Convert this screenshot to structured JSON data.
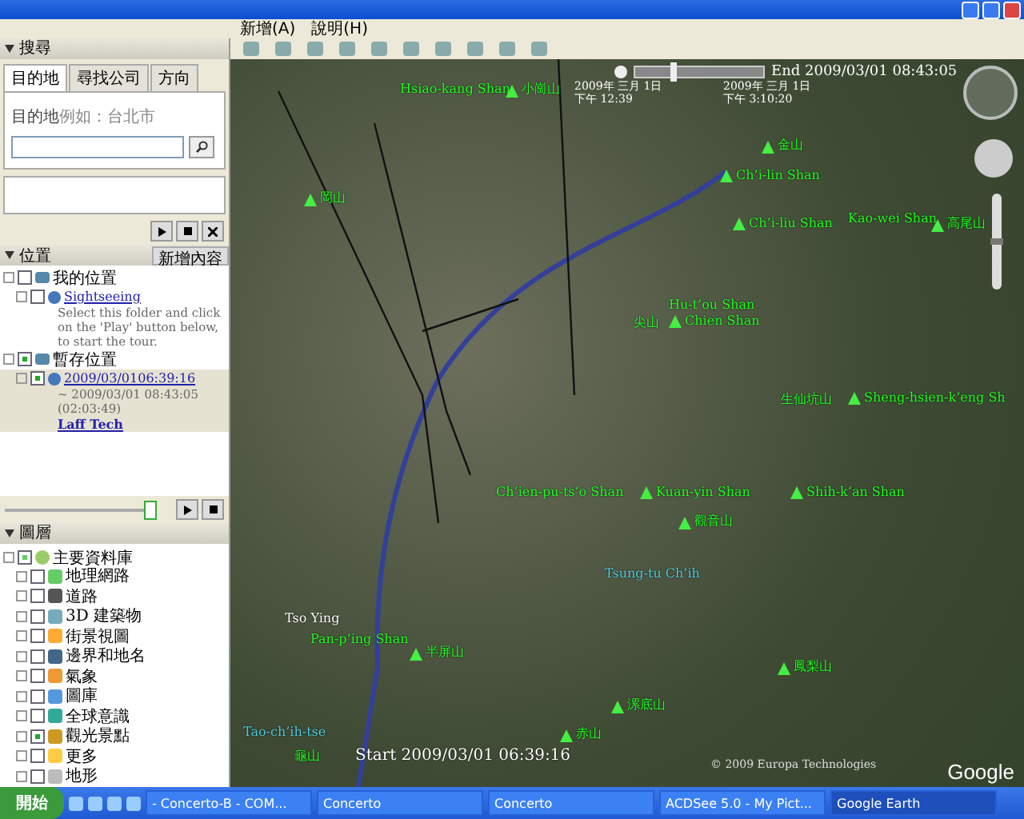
{
  "menu": [
    "新增(A)",
    "說明(H)"
  ],
  "search": {
    "title": "搜尋",
    "tabs": [
      {
        "label": "目的地",
        "selected": true
      },
      {
        "label": "尋找公司",
        "selected": false
      },
      {
        "label": "方向",
        "selected": false
      }
    ],
    "label": "目的地",
    "hint": "例如：台北市"
  },
  "places": {
    "title": "位置",
    "add_button": "新增內容",
    "items": [
      {
        "label": "我的位置",
        "checked": false,
        "expanded": true,
        "children": [
          {
            "label": "Sightseeing",
            "checked": false,
            "link": true,
            "description": "Select this folder and click on the 'Play' button below, to start the tour.",
            "selected": false
          }
        ]
      },
      {
        "label": "暫存位置",
        "checked": true,
        "expanded": true,
        "children": [
          {
            "label": "2009/03/0106:39:16",
            "checked": true,
            "link": true,
            "description": "~ 2009/03/01 08:43:05 (02:03:49)",
            "author": "Laff Tech",
            "selected": true
          }
        ]
      }
    ],
    "slider": {
      "level": 0.97
    }
  },
  "layers": {
    "title": "圖層",
    "root": {
      "label": "主要資料庫",
      "checked": true,
      "children": [
        {
          "label": "地理網路",
          "checked": false
        },
        {
          "label": "道路",
          "checked": false
        },
        {
          "label": "3D 建築物",
          "checked": false
        },
        {
          "label": "街景視圖",
          "checked": false
        },
        {
          "label": "邊界和地名",
          "checked": false
        },
        {
          "label": "氣象",
          "checked": false
        },
        {
          "label": "圖庫",
          "checked": false
        },
        {
          "label": "全球意識",
          "checked": false
        },
        {
          "label": "觀光景點",
          "checked": true
        },
        {
          "label": "更多",
          "checked": false
        },
        {
          "label": "地形",
          "checked": false
        }
      ]
    }
  },
  "time": {
    "end": "End 2009/03/01 08:43:05",
    "left_date": "2009年 三月 1日",
    "left_time": "下午 12:39",
    "right_date": "2009年 三月 1日",
    "right_time": "下午 3:10:20",
    "level": 0.3
  },
  "map_labels": [
    {
      "text": "Hsiao-kang Shan",
      "kind": "place"
    },
    {
      "text": "小崗山",
      "kind": "peak"
    },
    {
      "text": "金山",
      "kind": "peak"
    },
    {
      "text": "Ch’i-lin Shan",
      "kind": "peak"
    },
    {
      "text": "Ch’i-liu Shan",
      "kind": "peak"
    },
    {
      "text": "Kao-wei Shan",
      "kind": "place"
    },
    {
      "text": "高尾山",
      "kind": "peak"
    },
    {
      "text": "岡山",
      "kind": "peak"
    },
    {
      "text": "Hu-t’ou Shan",
      "kind": "place"
    },
    {
      "text": "尖山",
      "kind": "place"
    },
    {
      "text": "Chien Shan",
      "kind": "peak"
    },
    {
      "text": "生仙坑山",
      "kind": "place"
    },
    {
      "text": "Sheng-hsien-k’eng Sh",
      "kind": "peak"
    },
    {
      "text": "Ch’ien-pu-ts’o Shan",
      "kind": "place"
    },
    {
      "text": "Kuan-yin Shan",
      "kind": "peak"
    },
    {
      "text": "Shih-k’an Shan",
      "kind": "peak"
    },
    {
      "text": "觀音山",
      "kind": "peak"
    },
    {
      "text": "Tsung-tu Ch’ih",
      "kind": "water"
    },
    {
      "text": "Tso Ying",
      "kind": "town"
    },
    {
      "text": "Pan-p’ing Shan",
      "kind": "place"
    },
    {
      "text": "半屏山",
      "kind": "peak"
    },
    {
      "text": "鳳梨山",
      "kind": "peak"
    },
    {
      "text": "漯底山",
      "kind": "peak"
    },
    {
      "text": "赤山",
      "kind": "peak"
    },
    {
      "text": "Tao-ch’ih-tse",
      "kind": "water"
    },
    {
      "text": "龜山",
      "kind": "place"
    },
    {
      "text": "Start 2009/03/01 06:39:16",
      "kind": "track"
    }
  ],
  "zoom": {
    "level": 0.5
  },
  "copyright": "© 2009 Europa Technologies",
  "logo": "Google",
  "taskbar": {
    "start": "開始",
    "tasks": [
      {
        "label": "- Concerto-B - COM...",
        "selected": false
      },
      {
        "label": "Concerto",
        "selected": false
      },
      {
        "label": "Concerto",
        "selected": false
      },
      {
        "label": "ACDSee 5.0 - My Pict...",
        "selected": false
      },
      {
        "label": "Google Earth",
        "selected": true
      }
    ]
  }
}
